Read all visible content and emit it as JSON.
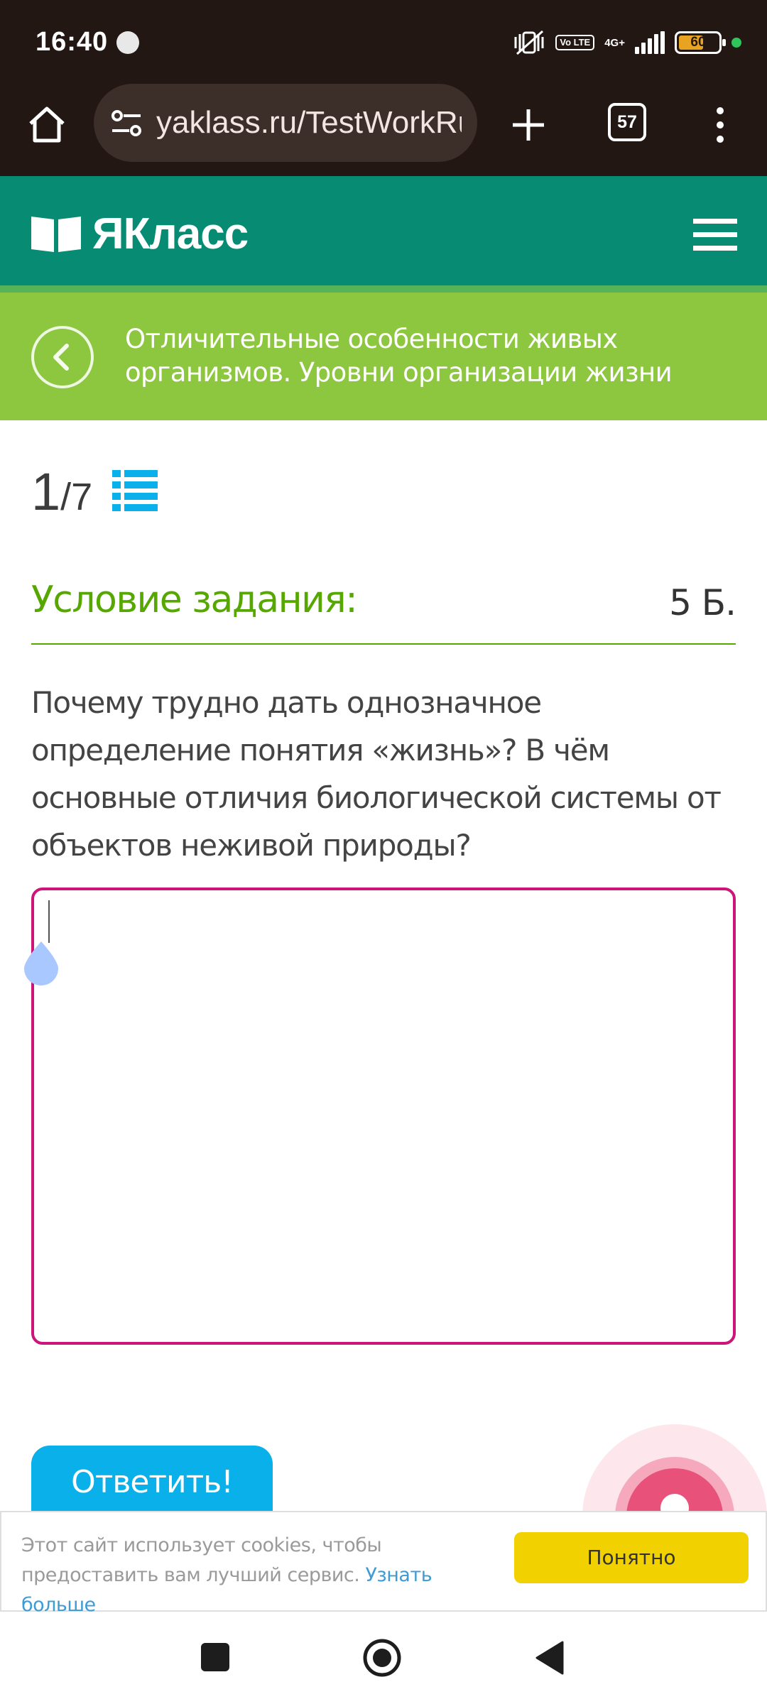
{
  "status_bar": {
    "time": "16:40",
    "volte_label": "Vo LTE",
    "network": "4G+",
    "battery": "60"
  },
  "browser": {
    "url": "yaklass.ru/TestWorkRu",
    "tab_count": "57",
    "icons": [
      "home-icon",
      "site-settings-icon",
      "new-tab-icon",
      "tabs-icon",
      "menu-icon"
    ]
  },
  "site": {
    "logo": "ЯКласс",
    "topic_title": "Отличительные особенности живых организмов. Уровни организации жизни"
  },
  "task": {
    "current": "1",
    "separator_total": "/7",
    "condition_label": "Условие задания:",
    "points": "5 Б.",
    "question": "Почему трудно дать однозначное определение понятия «жизнь»? В чём основные отличия биологической системы от объектов неживой природы?",
    "answer_value": "",
    "submit_label": "Ответить!"
  },
  "cookie": {
    "text": "Этот сайт использует cookies, чтобы предоставить вам лучший сервис.",
    "link": "Узнать больше",
    "button": "Понятно"
  },
  "colors": {
    "status_bg": "#231714",
    "header_teal": "#078b72",
    "topic_green": "#8dc63f",
    "condition_green": "#56a800",
    "answer_border": "#cc1479",
    "submit_blue": "#0ab0ea",
    "cookie_yellow": "#f2d100"
  }
}
